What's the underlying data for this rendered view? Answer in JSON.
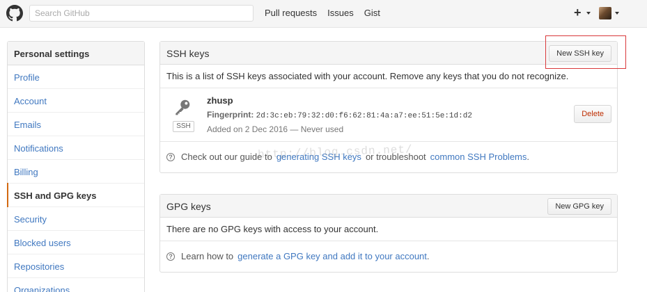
{
  "header": {
    "search_placeholder": "Search GitHub",
    "nav": [
      "Pull requests",
      "Issues",
      "Gist"
    ],
    "plus_label": "+",
    "logo_icon": "github-octocat-icon"
  },
  "sidebar": {
    "title": "Personal settings",
    "items": [
      {
        "label": "Profile",
        "selected": false
      },
      {
        "label": "Account",
        "selected": false
      },
      {
        "label": "Emails",
        "selected": false
      },
      {
        "label": "Notifications",
        "selected": false
      },
      {
        "label": "Billing",
        "selected": false
      },
      {
        "label": "SSH and GPG keys",
        "selected": true
      },
      {
        "label": "Security",
        "selected": false
      },
      {
        "label": "Blocked users",
        "selected": false
      },
      {
        "label": "Repositories",
        "selected": false
      },
      {
        "label": "Organizations",
        "selected": false
      }
    ],
    "selected_accent": "#d26911"
  },
  "ssh": {
    "title": "SSH keys",
    "new_button": "New SSH key",
    "description": "This is a list of SSH keys associated with your account. Remove any keys that you do not recognize.",
    "key": {
      "name": "zhusp",
      "fingerprint_label": "Fingerprint:",
      "fingerprint": "2d:3c:eb:79:32:d0:f6:62:81:4a:a7:ee:51:5e:1d:d2",
      "added": "Added on 2 Dec 2016 — Never used",
      "type": "SSH",
      "delete_button": "Delete"
    },
    "help_prefix": "Check out our guide to",
    "help_link1": "generating SSH keys",
    "help_middle": "or troubleshoot",
    "help_link2": "common SSH Problems",
    "help_suffix": "."
  },
  "gpg": {
    "title": "GPG keys",
    "new_button": "New GPG key",
    "description": "There are no GPG keys with access to your account.",
    "help_prefix": "Learn how to",
    "help_link": "generate a GPG key and add it to your account",
    "help_suffix": "."
  },
  "watermark": "http://blog.csdn.net/",
  "colors": {
    "link": "#4078c0",
    "danger": "#bd2c00",
    "highlight": "#d9383a"
  }
}
